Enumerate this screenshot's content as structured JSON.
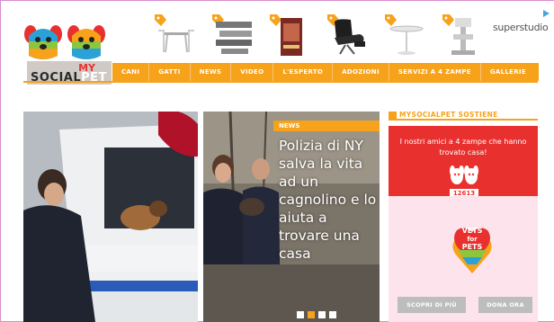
{
  "brand": {
    "logo_my": "MY",
    "logo_social": "SOCIAL",
    "logo_pet": "PET"
  },
  "products": [
    {
      "icon": "tag-icon",
      "name": "dining-table-icon"
    },
    {
      "icon": "tag-icon",
      "name": "shelf-icon"
    },
    {
      "icon": "tag-icon",
      "name": "book-icon"
    },
    {
      "icon": "tag-icon",
      "name": "armchair-icon"
    },
    {
      "icon": "tag-icon",
      "name": "side-table-icon"
    },
    {
      "icon": "tag-icon",
      "name": "cat-tower-icon"
    }
  ],
  "sponsor": "superstudio",
  "nav": {
    "items": [
      "CANI",
      "GATTI",
      "NEWS",
      "VIDEO",
      "L'ESPERTO",
      "ADOZIONI",
      "SERVIZI A 4 ZAMPE",
      "GALLERIE"
    ]
  },
  "feature": {
    "badge": "NEWS",
    "headline": "Polizia di NY salva la vita ad un cagnolino e lo aiuta a trovare una casa"
  },
  "sidebar": {
    "title": "MYSOCIALPET SOSTIENE",
    "text": "I nostri amici a 4 zampe che hanno trovato casa!",
    "count": "12613",
    "vets_line1": "VETS",
    "vets_line2": "for",
    "vets_line3": "PETS",
    "button_left": "SCOPRI DI PIÙ",
    "button_right": "DONA ORA"
  },
  "colors": {
    "accent": "#f7a21b",
    "red": "#e8312f",
    "pink": "#fce3ec"
  }
}
